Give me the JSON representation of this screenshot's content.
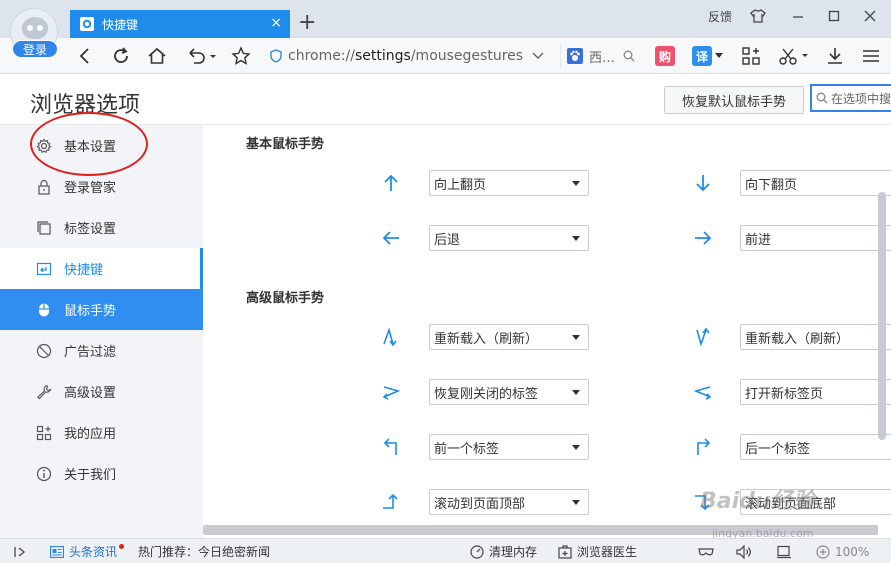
{
  "browser": {
    "login_label": "登录",
    "tab_title": "快捷键",
    "feedback_label": "反馈",
    "url_scheme": "chrome://",
    "url_host": "settings",
    "url_path": "/mousegestures",
    "search_engine_text": "西…",
    "ext_gou_label": "购",
    "ext_yi_label": "译",
    "accent_color": "#1e8cea"
  },
  "header": {
    "title": "浏览器选项",
    "restore_button": "恢复默认鼠标手势",
    "search_placeholder": "在选项中搜"
  },
  "sidebar": {
    "items": [
      {
        "label": "基本设置",
        "icon": "gear-icon"
      },
      {
        "label": "登录管家",
        "icon": "lock-icon"
      },
      {
        "label": "标签设置",
        "icon": "tabs-icon"
      },
      {
        "label": "快捷键",
        "icon": "shortcut-icon"
      },
      {
        "label": "鼠标手势",
        "icon": "mouse-icon"
      },
      {
        "label": "广告过滤",
        "icon": "block-icon"
      },
      {
        "label": "高级设置",
        "icon": "wrench-icon"
      },
      {
        "label": "我的应用",
        "icon": "apps-icon"
      },
      {
        "label": "关于我们",
        "icon": "info-icon"
      }
    ]
  },
  "content": {
    "basic_title": "基本鼠标手势",
    "advanced_title": "高级鼠标手势",
    "basic": [
      {
        "left": "向上翻页",
        "right": "向下翻页"
      },
      {
        "left": "后退",
        "right": "前进"
      }
    ],
    "advanced": [
      {
        "left": "重新载入（刷新）",
        "right": "重新载入（刷新）"
      },
      {
        "left": "恢复刚关闭的标签",
        "right": "打开新标签页"
      },
      {
        "left": "前一个标签",
        "right": "后一个标签"
      },
      {
        "left": "滚动到页面顶部",
        "right": "滚动到页面底部"
      }
    ]
  },
  "watermark": {
    "main": "Baidu经验",
    "sub": "jingyan.baidu.com"
  },
  "statusbar": {
    "news_label": "头条资讯",
    "hot_label": "热门推荐：今日绝密新闻",
    "clean_label": "清理内存",
    "doctor_label": "浏览器医生",
    "zoom_label": "100%"
  }
}
